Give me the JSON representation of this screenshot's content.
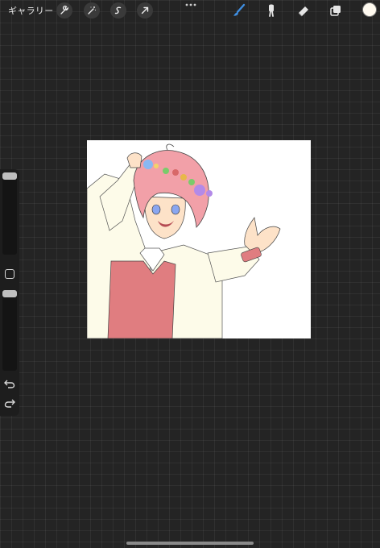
{
  "toolbar": {
    "gallery_label": "ギャラリー",
    "left_tools": [
      {
        "icon": "wrench-icon"
      },
      {
        "icon": "magic-wand-icon"
      },
      {
        "icon": "selection-icon"
      },
      {
        "icon": "transform-arrow-icon"
      }
    ],
    "more_icon": "ellipsis-icon",
    "right_tools": [
      {
        "icon": "brush-icon",
        "active": true
      },
      {
        "icon": "smudge-icon"
      },
      {
        "icon": "eraser-icon"
      },
      {
        "icon": "layers-icon"
      }
    ],
    "current_color": "#fffaf0",
    "active_tool_color": "#3f8ee0"
  },
  "sidebar": {
    "brush_size_level": 0.0,
    "opacity_level": 0.0,
    "modify_icon": "square-icon",
    "undo_icon": "undo-icon",
    "redo_icon": "redo-icon"
  },
  "artwork": {
    "description_icon": "illustration-icon"
  }
}
